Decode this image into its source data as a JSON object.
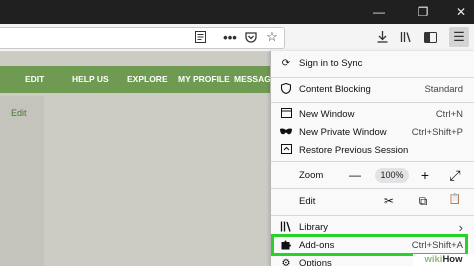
{
  "window": {
    "minimize": "—",
    "restore": "❐",
    "close": "✕"
  },
  "toolbar": {
    "reader_icon": "reader-icon",
    "page_actions": "•••",
    "pocket_icon": "pocket-icon",
    "bookmark_star": "☆",
    "download_icon": "download-icon",
    "library_icon": "library-icon",
    "sidebar_icon": "sidebar-icon",
    "menu_icon": "☰"
  },
  "site_nav": {
    "items": [
      "EDIT",
      "HELP US",
      "EXPLORE",
      "MY PROFILE",
      "MESSAG"
    ]
  },
  "page": {
    "edit_link": "Edit"
  },
  "menu": {
    "sign_in": "Sign in to Sync",
    "content_blocking": "Content Blocking",
    "content_blocking_value": "Standard",
    "new_window": "New Window",
    "new_window_shortcut": "Ctrl+N",
    "new_private_window": "New Private Window",
    "new_private_window_shortcut": "Ctrl+Shift+P",
    "restore_session": "Restore Previous Session",
    "zoom_label": "Zoom",
    "zoom_minus": "—",
    "zoom_value": "100%",
    "zoom_plus": "+",
    "fullscreen": "⤢",
    "edit_label": "Edit",
    "cut": "✂",
    "copy": "⧉",
    "paste": "📋",
    "library": "Library",
    "library_arrow": "›",
    "addons": "Add-ons",
    "addons_shortcut": "Ctrl+Shift+A",
    "options": "Options"
  },
  "watermark": {
    "wiki": "wiki",
    "how": "How"
  },
  "colors": {
    "nav_green": "#6f9a52",
    "highlight_green": "#2bd12b",
    "titlebar": "#202020"
  }
}
